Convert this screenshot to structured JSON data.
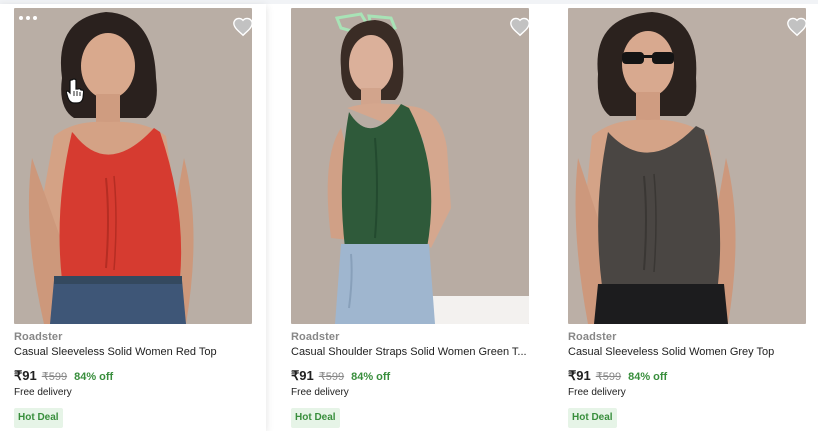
{
  "colors": {
    "price_text": "#212121",
    "secondary_text": "#878787",
    "discount_green": "#388e3c",
    "badge_bg": "#e6f4e7",
    "wishlist_grey": "#c2c2c2"
  },
  "icons": {
    "more": "more-options-icon",
    "wishlist": "heart-icon",
    "cursor": "hand-pointer-icon"
  },
  "products": [
    {
      "brand": "Roadster",
      "title": "Casual Sleeveless Solid Women Red Top",
      "price": "₹91",
      "mrp": "₹599",
      "discount": "84% off",
      "delivery": "Free delivery",
      "badge": "Hot Deal",
      "image_alt": "Model wearing red sleeveless ruched top"
    },
    {
      "brand": "Roadster",
      "title": "Casual Shoulder Straps Solid Women Green T...",
      "price": "₹91",
      "mrp": "₹599",
      "discount": "84% off",
      "delivery": "Free delivery",
      "badge": "Hot Deal",
      "image_alt": "Model wearing green shoulder strap top"
    },
    {
      "brand": "Roadster",
      "title": "Casual Sleeveless Solid Women Grey Top",
      "price": "₹91",
      "mrp": "₹599",
      "discount": "84% off",
      "delivery": "Free delivery",
      "badge": "Hot Deal",
      "image_alt": "Model wearing grey sleeveless ruched top"
    }
  ]
}
